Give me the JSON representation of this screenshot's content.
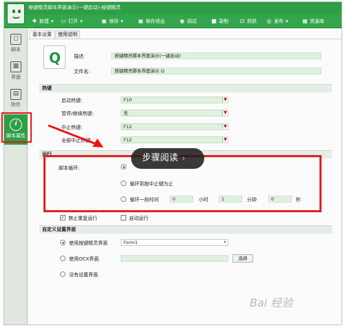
{
  "window": {
    "title": "按键精灵脚本界面演示(一键启动)-按键精灵"
  },
  "toolbar": {
    "items": [
      {
        "icon": "plus-icon",
        "label": "新建"
      },
      {
        "icon": "folder-icon",
        "label": "打开"
      },
      {
        "icon": "save-icon",
        "label": "保存"
      },
      {
        "icon": "save-exit-icon",
        "label": "保存退出"
      },
      {
        "icon": "play-icon",
        "label": "调试"
      },
      {
        "icon": "record-icon",
        "label": "录制"
      },
      {
        "icon": "capture-icon",
        "label": "抓抓"
      },
      {
        "icon": "publish-icon",
        "label": "发布"
      },
      {
        "icon": "resource-icon",
        "label": "资源库"
      }
    ],
    "dropdown_arrow": "▾"
  },
  "sidebar": {
    "items": [
      {
        "label": "脚本",
        "glyph": "◻"
      },
      {
        "label": "界面",
        "glyph": "▦"
      },
      {
        "label": "附件",
        "glyph": "▤"
      },
      {
        "label": "脚本属性",
        "glyph": "i"
      }
    ]
  },
  "tabs": [
    "基本设置",
    "使用说明"
  ],
  "basic": {
    "icon_letter": "Q",
    "desc_label": "描述:",
    "desc_value": "按键精灵脚本界面演示(一键启动)",
    "filename_label": "文件名:",
    "filename_value": "按键精灵脚本界面演示.Q"
  },
  "hotkeys": {
    "section": "热键",
    "rows": [
      {
        "label": "启动热键:",
        "value": "F10"
      },
      {
        "label": "暂停/继续热键:",
        "value": "无"
      },
      {
        "label": "中止热键:",
        "value": "F12"
      },
      {
        "label": "全部中止热键:",
        "value": "F12"
      }
    ]
  },
  "run": {
    "section": "运行",
    "loop_label": "脚本循环:",
    "opt_stop": "循环到按中止键为止",
    "opt_time": "循环一段时间",
    "hours_value": "0",
    "hours_unit": "小时",
    "minutes_value": "1",
    "minutes_unit": "分钟",
    "seconds_value": "0",
    "seconds_unit": "秒",
    "no_repeat": "禁止重复运行",
    "auto_run": "自动运行"
  },
  "custom": {
    "section": "自定义设置界面",
    "opt_builtin": "使用按键精灵界面",
    "form_value": "Form1",
    "opt_ocx": "使用OCX界面",
    "choose_btn": "选择",
    "opt_none": "没有设置界面"
  },
  "overlay": {
    "text": "步骤阅读",
    "chevron": "›"
  },
  "watermark": "Bai 经验",
  "colors": {
    "brand_green": "#2f9e46",
    "highlight_red": "#e02020",
    "field_green": "#dff1df"
  }
}
